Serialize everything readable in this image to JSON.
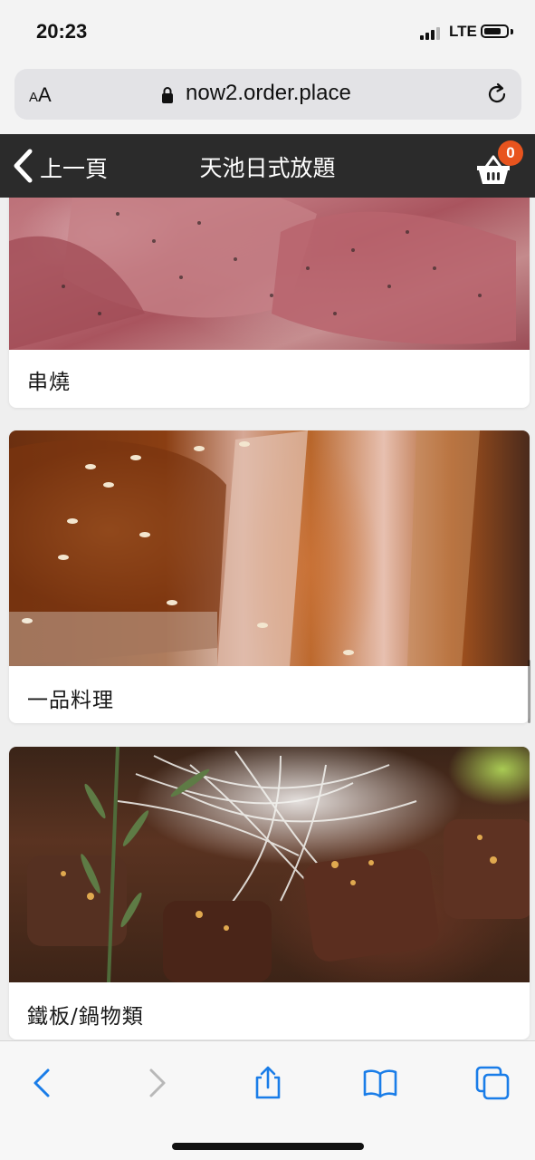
{
  "status_bar": {
    "time": "20:23",
    "network": "LTE",
    "signal_bars_active": 3,
    "signal_bars_total": 4
  },
  "browser": {
    "text_size_button": "AA",
    "url": "now2.order.place",
    "icons": {
      "lock": "lock-icon",
      "reload": "reload-icon",
      "back": "chevron-left-icon",
      "forward": "chevron-right-icon",
      "share": "share-icon",
      "bookmarks": "book-icon",
      "tabs": "tabs-icon"
    }
  },
  "header": {
    "back_label": "上一頁",
    "title": "天池日式放題",
    "cart_count": "0",
    "background_color": "#2b2b2b",
    "badge_color": "#e8541e"
  },
  "categories": [
    {
      "label": "串燒"
    },
    {
      "label": "一品料理"
    },
    {
      "label": "鐵板/鍋物類"
    }
  ],
  "colors": {
    "toolbar_accent": "#1a7de8"
  }
}
